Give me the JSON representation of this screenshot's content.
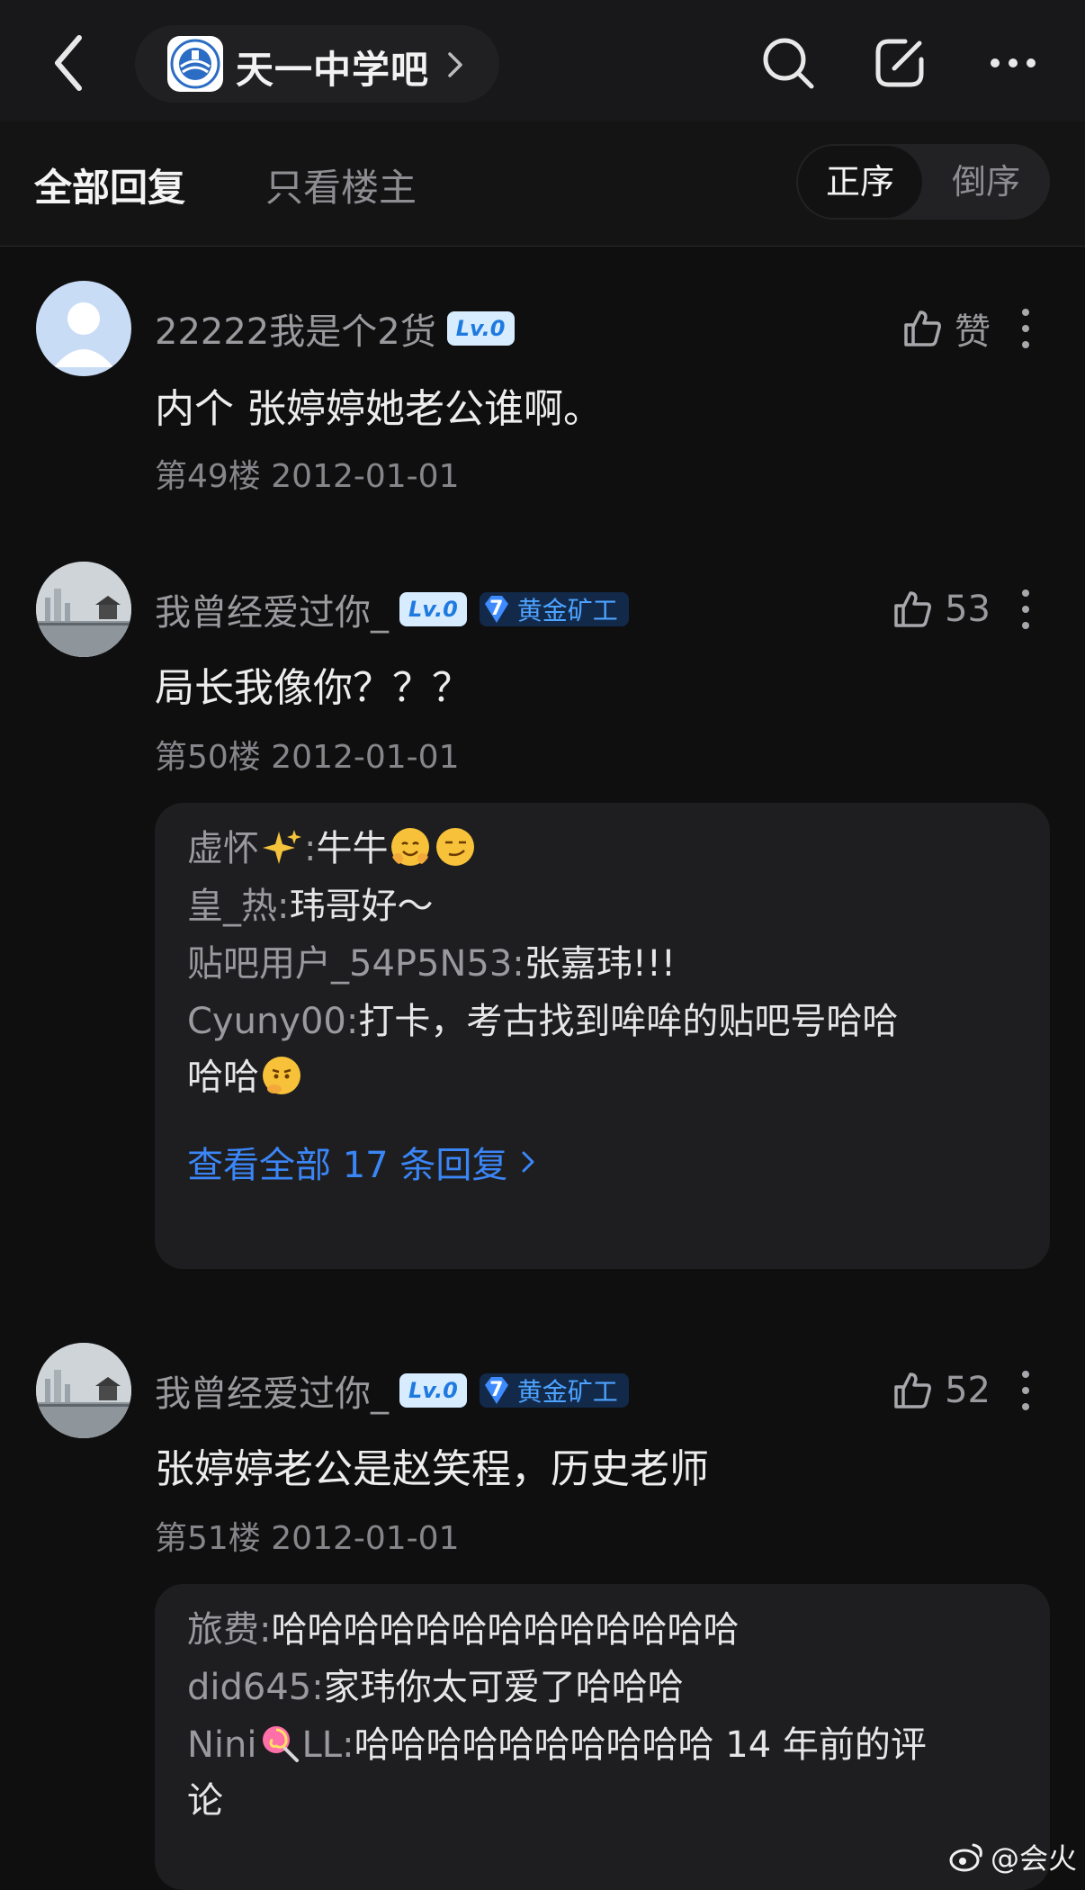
{
  "header": {
    "forum_name": "天一中学吧"
  },
  "tabs": {
    "all_replies": "全部回复",
    "owner_only": "只看楼主",
    "order_asc": "正序",
    "order_desc": "倒序"
  },
  "posts": [
    {
      "username": "22222我是个2货",
      "level": "Lv.0",
      "like_label": "赞",
      "content": "内个 张婷婷她老公谁啊。",
      "floor": "第49楼",
      "date": "2012-01-01"
    },
    {
      "username": "我曾经爱过你_",
      "level": "Lv.0",
      "badge_level": "7",
      "badge_title": "黄金矿工",
      "like_count": "53",
      "content": "局长我像你？？？",
      "floor": "第50楼",
      "date": "2012-01-01",
      "replies": [
        {
          "name": "虚怀",
          "sep": ":",
          "text": "牛牛"
        },
        {
          "name": "皇_热",
          "sep": ":",
          "text": "玮哥好～"
        },
        {
          "name": "贴吧用户_54P5N53",
          "sep": ":",
          "text": "张嘉玮!!!"
        },
        {
          "name": "Cyuny00",
          "sep": ":",
          "text": "打卡，考古找到哞哞的贴吧号哈哈",
          "text2": "哈哈"
        }
      ],
      "view_all": "查看全部 17 条回复"
    },
    {
      "username": "我曾经爱过你_",
      "level": "Lv.0",
      "badge_level": "7",
      "badge_title": "黄金矿工",
      "like_count": "52",
      "content": "张婷婷老公是赵笑程，历史老师",
      "floor": "第51楼",
      "date": "2012-01-01",
      "replies": [
        {
          "name": "旅费",
          "sep": ":",
          "text": "哈哈哈哈哈哈哈哈哈哈哈哈哈"
        },
        {
          "name": "did645",
          "sep": ":",
          "text": "家玮你太可爱了哈哈哈"
        },
        {
          "name": "Nini",
          "name2": "LL",
          "sep": ":",
          "text": "哈哈哈哈哈哈哈哈哈哈 14 年前的评",
          "text2": "论"
        }
      ]
    }
  ],
  "watermark": "@会火",
  "colors": {
    "background": "#0f0f10",
    "accent_link": "#3b86f7",
    "level_badge": "#d7ecff",
    "rank_badge": "#13294a"
  }
}
